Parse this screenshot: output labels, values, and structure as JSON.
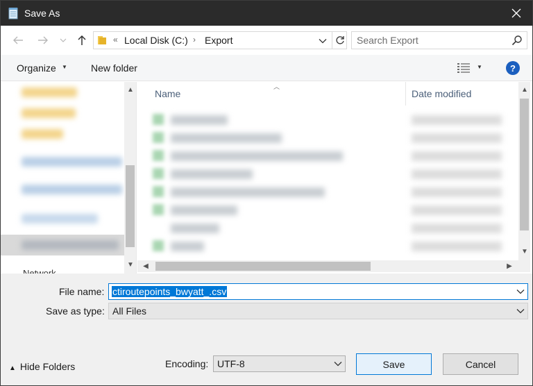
{
  "window": {
    "title": "Save As",
    "accent": "#0078d7",
    "titlebar_color": "#2b2b2b"
  },
  "icons": {
    "app": "notepad-icon",
    "close": "close-icon",
    "back": "arrow-left-icon",
    "forward": "arrow-right-icon",
    "recent": "chevron-down-icon",
    "up": "arrow-up-icon",
    "folder": "folder-icon",
    "refresh": "refresh-icon",
    "search": "search-icon",
    "view": "details-view-icon",
    "help": "help-icon"
  },
  "address": {
    "overflow": "«",
    "crumbs": [
      "Local Disk (C:)",
      "Export"
    ],
    "separator": "›"
  },
  "search": {
    "placeholder": "Search Export"
  },
  "toolbar": {
    "organize_label": "Organize",
    "new_folder_label": "New folder",
    "help_label": "?"
  },
  "navpane": {
    "network_label": "Network"
  },
  "filelist": {
    "columns": [
      "Name",
      "Date modified"
    ]
  },
  "form": {
    "file_name_label": "File name:",
    "file_name_value": "ctiroutepoints_bwyatt_.csv",
    "save_type_label": "Save as type:",
    "save_type_value": "All Files",
    "encoding_label": "Encoding:",
    "encoding_value": "UTF-8"
  },
  "footer": {
    "hide_folders_label": "Hide Folders",
    "save_label": "Save",
    "cancel_label": "Cancel"
  }
}
